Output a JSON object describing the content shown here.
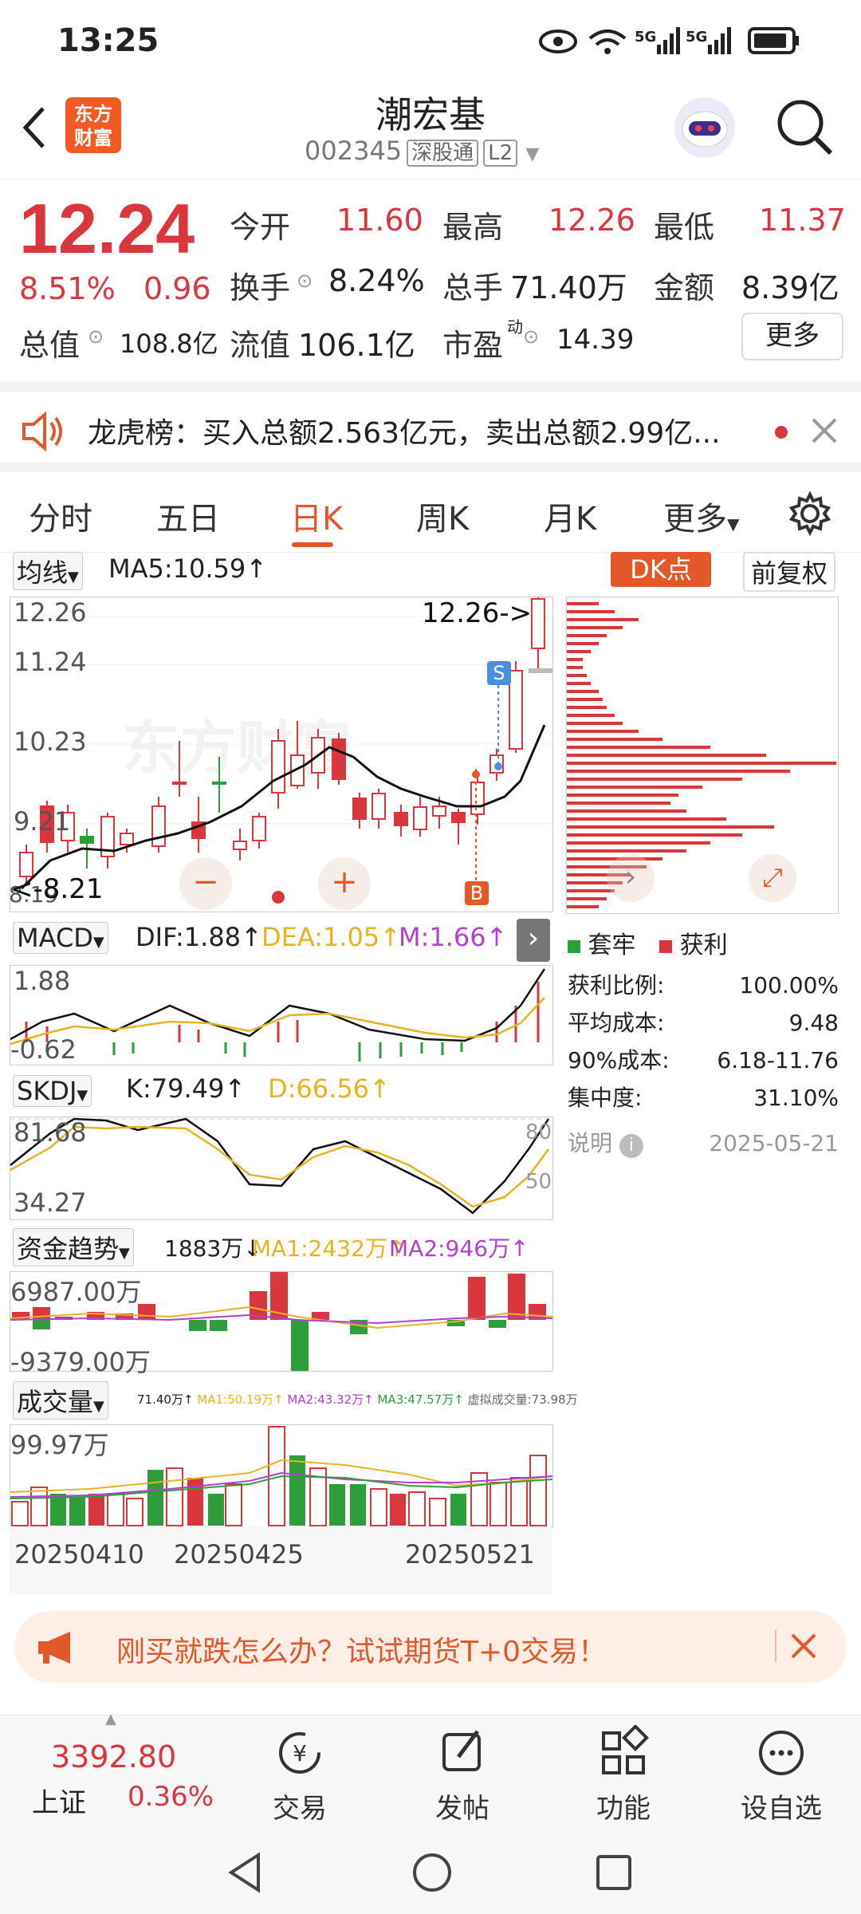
{
  "status_bar": {
    "time": "13:25",
    "net1": "5G",
    "net2": "5G"
  },
  "header": {
    "logo_text": "东方财富",
    "name": "潮宏基",
    "code": "002345",
    "tag1": "深股通",
    "tag2": "L2"
  },
  "quote": {
    "price": "12.24",
    "change_pct": "8.51%",
    "change": "0.96",
    "open_label": "今开",
    "open": "11.60",
    "high_label": "最高",
    "high": "12.26",
    "low_label": "最低",
    "low": "11.37",
    "turnover_label": "换手",
    "turnover": "8.24%",
    "volume_label": "总手",
    "volume": "71.40万",
    "amount_label": "金额",
    "amount": "8.39亿",
    "mktcap_label": "总值",
    "mktcap": "108.8亿",
    "float_label": "流值",
    "float": "106.1亿",
    "pe_label": "市盈",
    "pe_sup": "动",
    "pe": "14.39",
    "more": "更多"
  },
  "notice": {
    "text": "龙虎榜：买入总额2.563亿元，卖出总额2.99亿..."
  },
  "tabs": [
    "分时",
    "五日",
    "日K",
    "周K",
    "月K",
    "更多"
  ],
  "kline": {
    "ma_dropdown": "均线",
    "ma5": "MA5:10.59↑",
    "dk_label": "DK点",
    "adjust": "前复权",
    "y_labels": [
      "12.26",
      "11.24",
      "10.23",
      "9.21",
      "8.19"
    ],
    "high_marker": "12.26->",
    "low_marker": "<-8.21",
    "s_mark": "S",
    "b_mark": "B",
    "watermark": "东方财富"
  },
  "chip": {
    "legend_trap": "套牢",
    "legend_profit": "获利",
    "rows": [
      {
        "label": "获利比例:",
        "value": "100.00%"
      },
      {
        "label": "平均成本:",
        "value": "9.48"
      },
      {
        "label": "90%成本:",
        "value": "6.18-11.76"
      },
      {
        "label": "集中度:",
        "value": "31.10%"
      }
    ],
    "note": "说明",
    "date": "2025-05-21"
  },
  "macd": {
    "name": "MACD",
    "dif": "DIF:1.88↑",
    "dea": "DEA:1.05↑",
    "m": "M:1.66↑",
    "top": "1.88",
    "bottom": "-0.62"
  },
  "skdj": {
    "name": "SKDJ",
    "k": "K:79.49↑",
    "d": "D:66.56↑",
    "top": "81.68",
    "bottom": "34.27",
    "l80": "80",
    "l50": "50"
  },
  "fund": {
    "name": "资金趋势",
    "val": "1883万↓",
    "ma1": "MA1:2432万↑",
    "ma2": "MA2:946万↑",
    "top": "6987.00万",
    "bottom": "-9379.00万"
  },
  "vol": {
    "name": "成交量",
    "v": "71.40万↑",
    "ma1": "MA1:50.19万↑",
    "ma2": "MA2:43.32万↑",
    "ma3": "MA3:47.57万↑",
    "virt": "虚拟成交量:73.98万",
    "top": "99.97万",
    "dates": [
      "20250410",
      "20250425",
      "20250521"
    ]
  },
  "ad": {
    "text": "刚买就跌怎么办？试试期货T+0交易！"
  },
  "bottom": {
    "index_value": "3392.80",
    "index_name": "上证",
    "index_pct": "0.36%",
    "items": [
      "交易",
      "发帖",
      "功能",
      "设自选"
    ]
  },
  "colors": {
    "up": "#d9363e",
    "down": "#2e9e3a",
    "accent": "#e2582a",
    "ma": "#e6b422"
  }
}
